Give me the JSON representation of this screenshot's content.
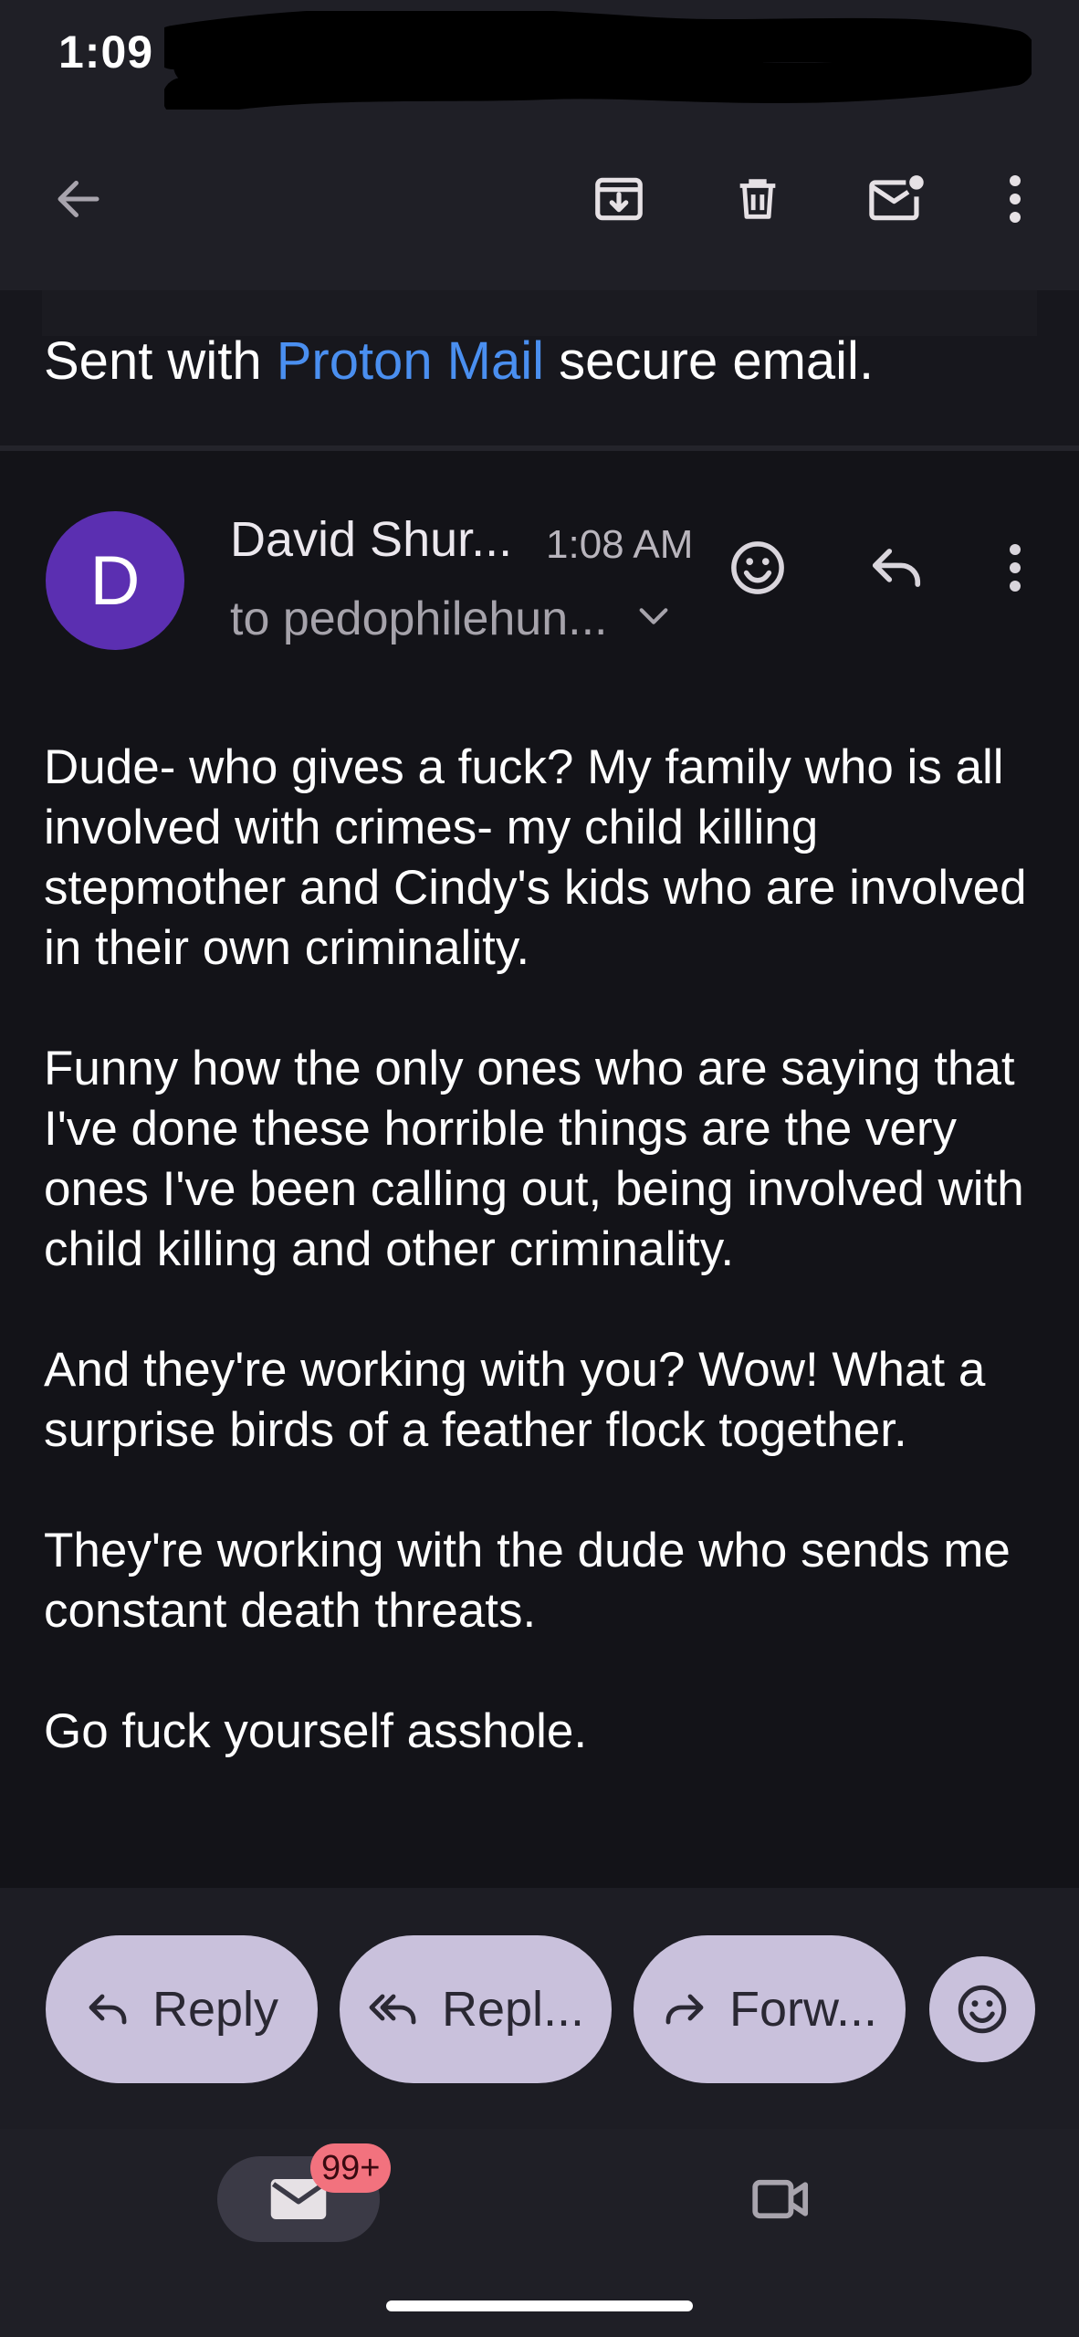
{
  "status_bar": {
    "time": "1:09"
  },
  "toolbar": {
    "back": "back-arrow-icon",
    "archive": "archive-icon",
    "delete": "delete-icon",
    "mark_unread": "mark-unread-icon",
    "more": "more-vertical-icon"
  },
  "quoted": {
    "prefix": "Sent with ",
    "link": "Proton Mail",
    "suffix": " secure email."
  },
  "message": {
    "avatar_letter": "D",
    "sender": "David Shur...",
    "time": "1:08 AM",
    "recipient": "to pedophilehun...",
    "body": [
      "Dude- who gives a fuck? My family who is all involved with crimes- my child killing stepmother and Cindy's kids who are involved in their own criminality.",
      "Funny how the only ones who are saying that I've done these horrible things are the very ones I've been calling out, being involved with child killing and other criminality.",
      "And they're working with you? Wow! What a surprise birds of a feather flock together.",
      "They're working with the dude who sends me constant death threats.",
      "Go fuck yourself asshole."
    ]
  },
  "actions": {
    "reply": "Reply",
    "reply_all": "Repl...",
    "forward": "Forw..."
  },
  "nav": {
    "badge": "99+"
  },
  "colors": {
    "background": "#131318",
    "bar": "#1f1f26",
    "avatar": "#5b2fb1",
    "link": "#4a8ff0",
    "pill": "#c9c1dc",
    "badge": "#f2727e"
  }
}
